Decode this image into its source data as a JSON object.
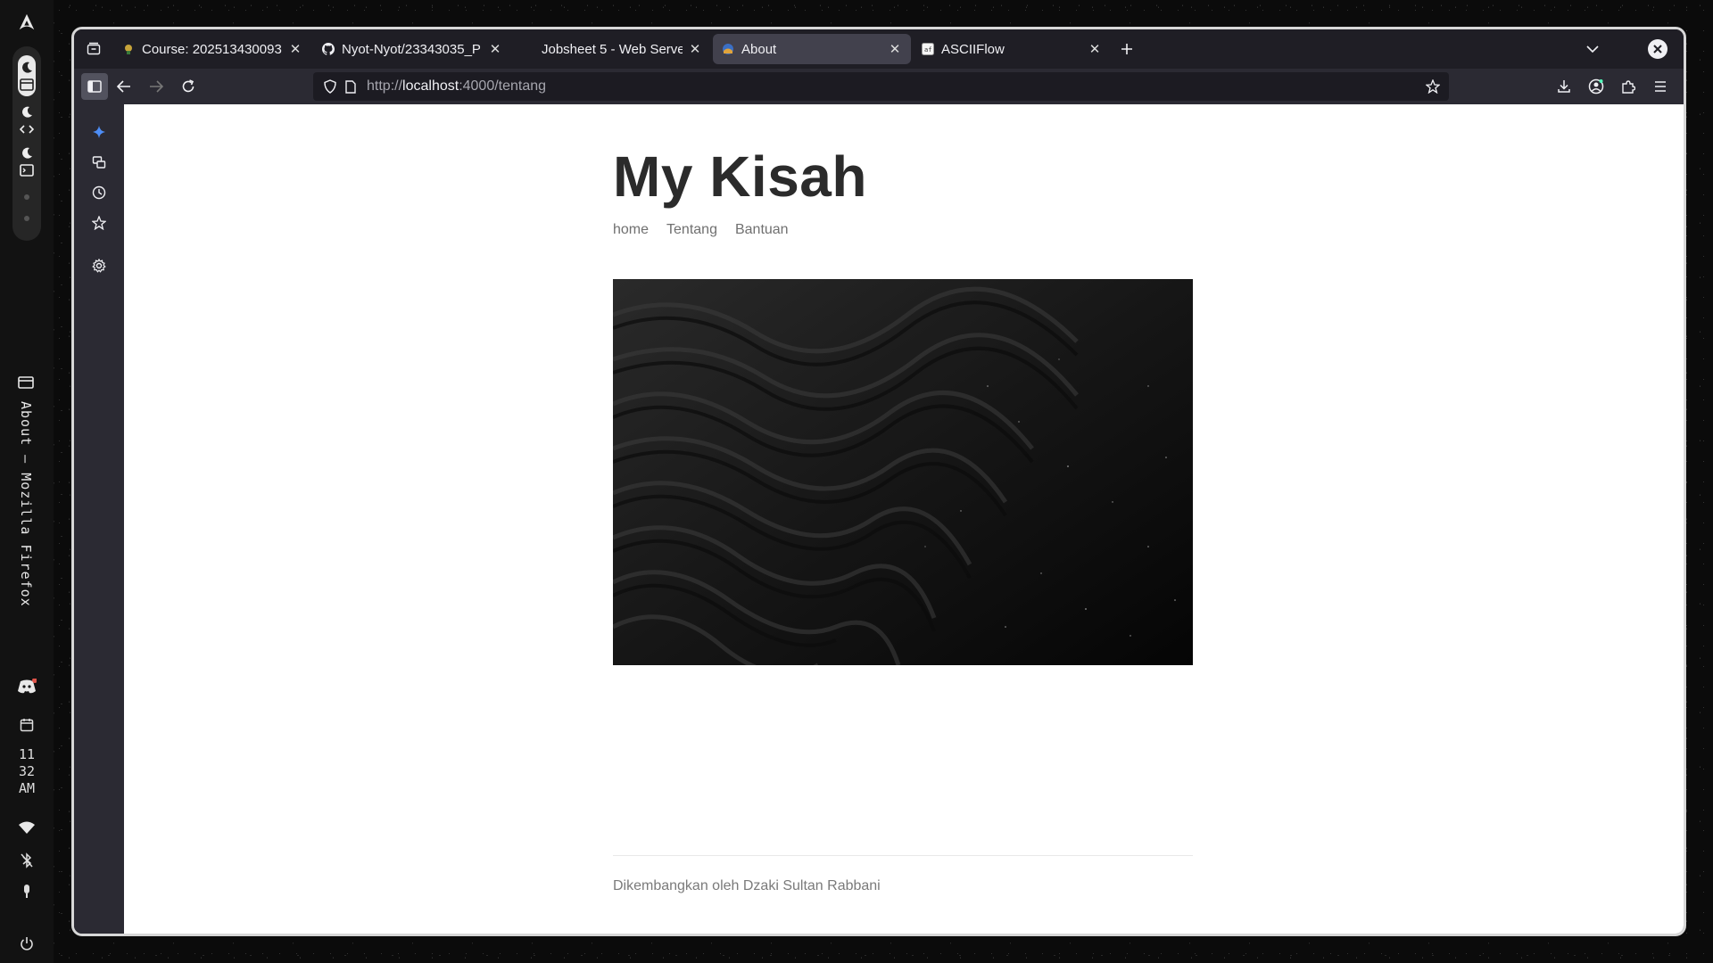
{
  "window_title": "About — Mozilla Firefox",
  "system": {
    "clock_hour": "11",
    "clock_minute": "32",
    "clock_ampm": "AM"
  },
  "tabs": [
    {
      "title": "Course: 202513430093",
      "favicon": "course-favicon",
      "active": false
    },
    {
      "title": "Nyot-Nyot/23343035_P",
      "favicon": "github-icon",
      "active": false
    },
    {
      "title": "Jobsheet 5 - Web Serve",
      "favicon": "none",
      "active": false
    },
    {
      "title": "About",
      "favicon": "site-favicon",
      "active": true
    },
    {
      "title": "ASCIIFlow",
      "favicon": "asciiflow-favicon",
      "active": false
    }
  ],
  "url": {
    "scheme": "http://",
    "host": "localhost",
    "rest": ":4000/tentang"
  },
  "site": {
    "title": "My Kisah",
    "nav": [
      "home",
      "Tentang",
      "Bantuan"
    ],
    "footer": "Dikembangkan oleh Dzaki Sultan Rabbani"
  },
  "colors": {
    "page_bg": "#ffffff",
    "title_color": "#2b2b2b",
    "nav_color": "#707070",
    "chrome_dark": "#1f1e25",
    "chrome": "#2b2a33"
  }
}
